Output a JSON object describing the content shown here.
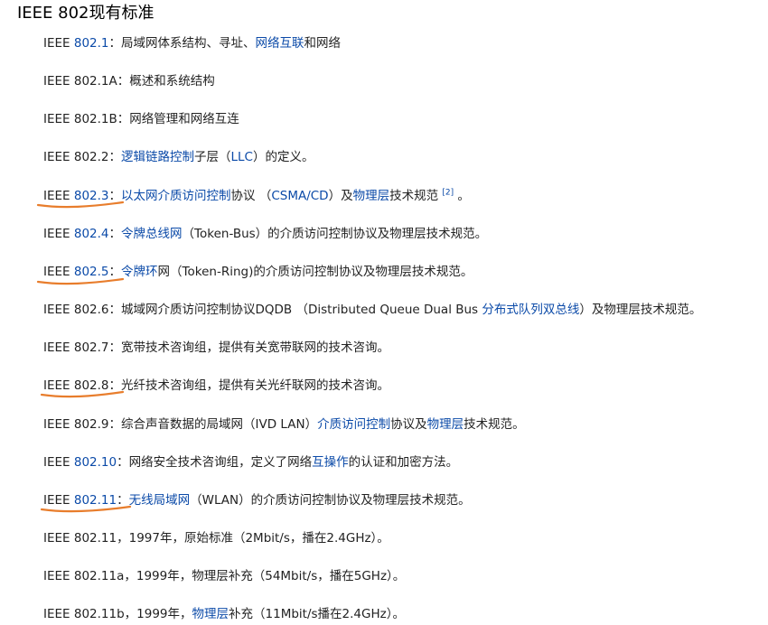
{
  "title": "IEEE 802现有标准",
  "colors": {
    "link": "#0b4aa8",
    "text": "#222222",
    "annotation": "#e87d2c"
  },
  "entries": [
    {
      "segments": [
        {
          "t": "IEEE "
        },
        {
          "t": "802.1",
          "link": true
        },
        {
          "t": "：局域网体系结构、寻址、"
        },
        {
          "t": "网络互联",
          "link": true
        },
        {
          "t": "和网络"
        }
      ]
    },
    {
      "segments": [
        {
          "t": "IEEE 802.1A：概述和系统结构"
        }
      ]
    },
    {
      "segments": [
        {
          "t": "IEEE 802.1B：网络管理和网络互连"
        }
      ]
    },
    {
      "segments": [
        {
          "t": "IEEE 802.2："
        },
        {
          "t": "逻辑链路控制",
          "link": true
        },
        {
          "t": "子层（"
        },
        {
          "t": "LLC",
          "link": true
        },
        {
          "t": "）的定义。"
        }
      ]
    },
    {
      "segments": [
        {
          "t": "IEEE "
        },
        {
          "t": "802.3",
          "link": true
        },
        {
          "t": "："
        },
        {
          "t": "以太网介质访问控制",
          "link": true
        },
        {
          "t": "协议 （"
        },
        {
          "t": "CSMA/CD",
          "link": true
        },
        {
          "t": "）及"
        },
        {
          "t": "物理层",
          "link": true
        },
        {
          "t": "技术规范 "
        },
        {
          "t": "[2]",
          "sup": true
        },
        {
          "t": " 。"
        }
      ]
    },
    {
      "segments": [
        {
          "t": "IEEE "
        },
        {
          "t": "802.4",
          "link": true
        },
        {
          "t": "："
        },
        {
          "t": "令牌总线网",
          "link": true
        },
        {
          "t": "（Token-Bus）的介质访问控制协议及物理层技术规范。"
        }
      ]
    },
    {
      "segments": [
        {
          "t": "IEEE "
        },
        {
          "t": "802.5",
          "link": true
        },
        {
          "t": "："
        },
        {
          "t": "令牌环",
          "link": true
        },
        {
          "t": "网（Token-Ring)的介质访问控制协议及物理层技术规范。"
        }
      ]
    },
    {
      "segments": [
        {
          "t": "IEEE 802.6：城域网介质访问控制协议DQDB （Distributed Queue Dual Bus "
        },
        {
          "t": "分布式队列双总线",
          "link": true
        },
        {
          "t": "）及物理层技术规范。"
        }
      ]
    },
    {
      "segments": [
        {
          "t": "IEEE 802.7：宽带技术咨询组，提供有关宽带联网的技术咨询。"
        }
      ]
    },
    {
      "segments": [
        {
          "t": "IEEE 802.8：光纤技术咨询组，提供有关光纤联网的技术咨询。"
        }
      ]
    },
    {
      "segments": [
        {
          "t": "IEEE 802.9：综合声音数据的局域网（IVD LAN）"
        },
        {
          "t": "介质访问控制",
          "link": true
        },
        {
          "t": "协议及"
        },
        {
          "t": "物理层",
          "link": true
        },
        {
          "t": "技术规范。"
        }
      ]
    },
    {
      "segments": [
        {
          "t": "IEEE "
        },
        {
          "t": "802.10",
          "link": true
        },
        {
          "t": "：网络安全技术咨询组，定义了网络"
        },
        {
          "t": "互操作",
          "link": true
        },
        {
          "t": "的认证和加密方法。"
        }
      ]
    },
    {
      "segments": [
        {
          "t": "IEEE "
        },
        {
          "t": "802.11",
          "link": true
        },
        {
          "t": "："
        },
        {
          "t": "无线局域网",
          "link": true
        },
        {
          "t": "（WLAN）的介质访问控制协议及物理层技术规范。"
        }
      ]
    },
    {
      "segments": [
        {
          "t": "IEEE 802.11，1997年，原始标准（2Mbit/s，播在2.4GHz）。"
        }
      ]
    },
    {
      "segments": [
        {
          "t": "IEEE 802.11a，1999年，物理层补充（54Mbit/s，播在5GHz）。"
        }
      ]
    },
    {
      "segments": [
        {
          "t": "IEEE 802.11b，1999年，"
        },
        {
          "t": "物理层",
          "link": true
        },
        {
          "t": "补充（11Mbit/s播在2.4GHz）。"
        }
      ]
    }
  ]
}
